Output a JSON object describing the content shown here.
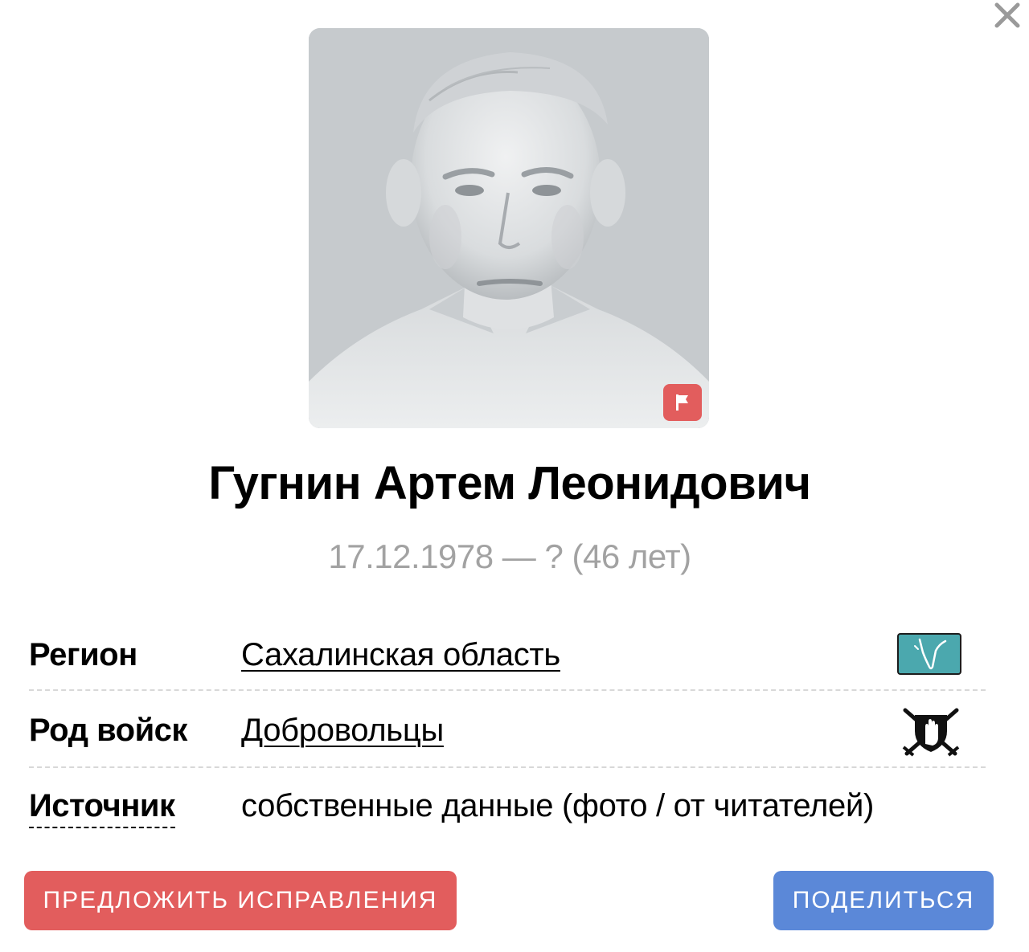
{
  "person": {
    "name": "Гугнин Артем Леонидович",
    "dates": "17.12.1978 — ? (46 лет)"
  },
  "details": {
    "region": {
      "label": "Регион",
      "value": "Сахалинская область",
      "icon": "sakhalin-map-icon"
    },
    "troops": {
      "label": "Род войск",
      "value": "Добровольцы",
      "icon": "volunteers-emblem-icon"
    },
    "source": {
      "label": "Источник",
      "value": "собственные данные (фото / от читателей)"
    }
  },
  "actions": {
    "suggest_label": "ПРЕДЛОЖИТЬ ИСПРАВЛЕНИЯ",
    "share_label": "ПОДЕЛИТЬСЯ"
  },
  "icons": {
    "close": "close-icon",
    "flag": "flag-icon"
  },
  "colors": {
    "suggest_button": "#e25d5d",
    "share_button": "#5b88d8",
    "flag_badge": "#e25d5d",
    "region_icon": "#4ba8ae",
    "dates_text": "#a2a2a2"
  }
}
